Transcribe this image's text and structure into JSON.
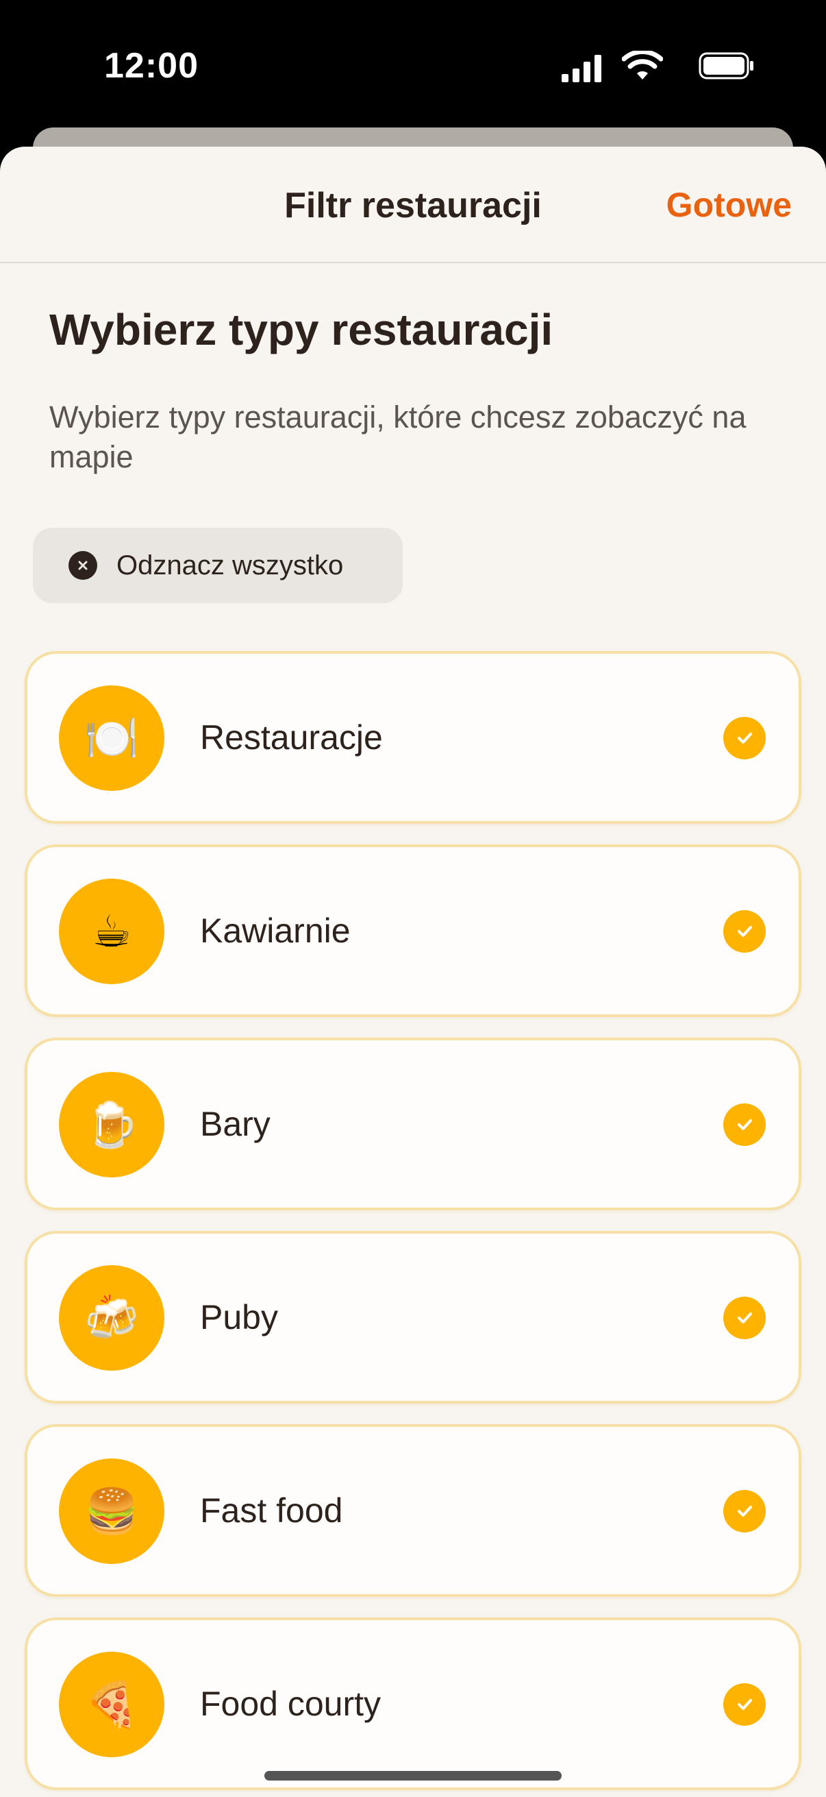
{
  "status_bar": {
    "time": "12:00",
    "icons": [
      "signal-icon",
      "wifi-icon",
      "battery-icon"
    ]
  },
  "nav": {
    "title": "Filtr restauracji",
    "done_label": "Gotowe"
  },
  "content": {
    "heading": "Wybierz typy restauracji",
    "subtitle": "Wybierz typy restauracji, które chcesz zobaczyć na mapie",
    "deselect_label": "Odznacz wszystko"
  },
  "items": [
    {
      "label": "Restauracje",
      "icon": "🍽️",
      "icon_name": "plate-cutlery-icon",
      "checked": true
    },
    {
      "label": "Kawiarnie",
      "icon": "☕",
      "icon_name": "coffee-cup-icon",
      "checked": true
    },
    {
      "label": "Bary",
      "icon": "🍺",
      "icon_name": "beer-mug-icon",
      "checked": true
    },
    {
      "label": "Puby",
      "icon": "🍻",
      "icon_name": "clinking-beers-icon",
      "checked": true
    },
    {
      "label": "Fast food",
      "icon": "🍔",
      "icon_name": "burger-icon",
      "checked": true
    },
    {
      "label": "Food courty",
      "icon": "🍕",
      "icon_name": "pizza-icon",
      "checked": true
    }
  ],
  "colors": {
    "accent": "#FDB300",
    "done": "#E8620F",
    "text": "#2D221C",
    "background": "#F8F5F1"
  }
}
